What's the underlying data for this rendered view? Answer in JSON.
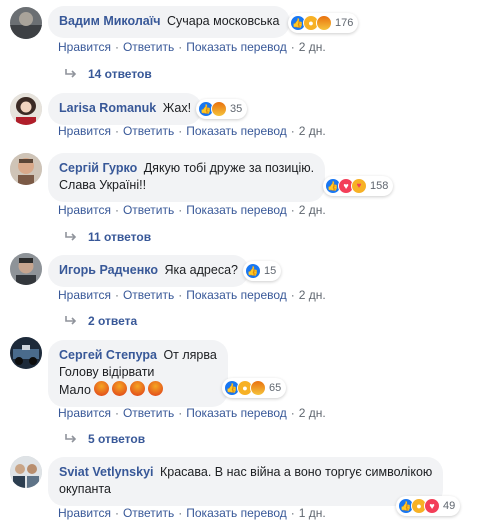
{
  "actions": {
    "like": "Нравится",
    "reply": "Ответить",
    "translate": "Показать перевод",
    "separator": "·"
  },
  "colors": {
    "author": "#385898",
    "bubble": "#f2f3f5",
    "meta": "#606770",
    "like": "#1877f2",
    "love": "#f33e58"
  },
  "comments": [
    {
      "author": "Вадим Миколаїч",
      "text": "Сучара московська",
      "reactions": [
        "like-icon",
        "wow-icon",
        "angry-icon"
      ],
      "reaction_count": "176",
      "time": "2 дн.",
      "replies": "14 ответов"
    },
    {
      "author": "Larisa Romanuk",
      "text": "Жах!",
      "reactions": [
        "like-icon",
        "angry-icon"
      ],
      "reaction_count": "35",
      "time": "2 дн.",
      "replies": ""
    },
    {
      "author": "Сергій Гурко",
      "text": "Дякую тобі друже за позицію.\nСлава Україні!!",
      "reactions": [
        "like-icon",
        "love-icon",
        "care-icon"
      ],
      "reaction_count": "158",
      "time": "2 дн.",
      "replies": "11 ответов"
    },
    {
      "author": "Игорь Радченко",
      "text": "Яка адреса?",
      "reactions": [
        "like-icon"
      ],
      "reaction_count": "15",
      "time": "2 дн.",
      "replies": "2 ответа"
    },
    {
      "author": "Сергей Степура",
      "text": "От лярва\nГолову відірвати\nМало",
      "reactions": [
        "like-icon",
        "wow-icon",
        "angry-icon"
      ],
      "reaction_count": "65",
      "time": "2 дн.",
      "replies": "5 ответов"
    },
    {
      "author": "Sviat Vetlynskyi",
      "text": "Красава. В нас війна а воно торгує символікою\nокупанта",
      "reactions": [
        "like-icon",
        "sad-icon",
        "love-icon"
      ],
      "reaction_count": "49",
      "time": "1 дн.",
      "replies": ""
    }
  ]
}
